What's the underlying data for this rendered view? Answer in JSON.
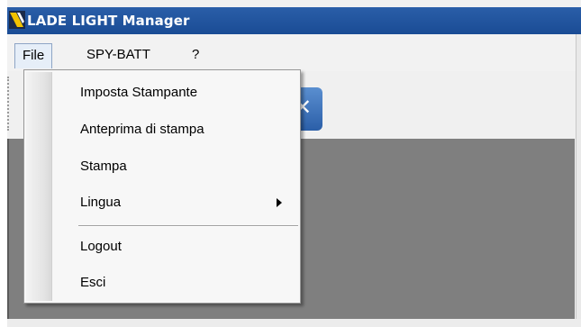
{
  "window": {
    "title": "LADE LIGHT Manager"
  },
  "menubar": {
    "items": [
      {
        "label": "File"
      },
      {
        "label": "SPY-BATT"
      },
      {
        "label": "?"
      }
    ]
  },
  "file_menu": {
    "items": [
      {
        "label": "Imposta Stampante"
      },
      {
        "label": "Anteprima di stampa"
      },
      {
        "label": "Stampa"
      },
      {
        "label": "Lingua"
      },
      {
        "label": "Logout"
      },
      {
        "label": "Esci"
      }
    ]
  },
  "colors": {
    "titlebar": "#1a4c95",
    "client_area": "#7f7f7f",
    "menu_background": "#f7f7f7"
  },
  "icons": {
    "app": "app-logo-icon",
    "submenu": "chevron-right-icon",
    "toolbar_button": "toolbar-x-icon"
  }
}
